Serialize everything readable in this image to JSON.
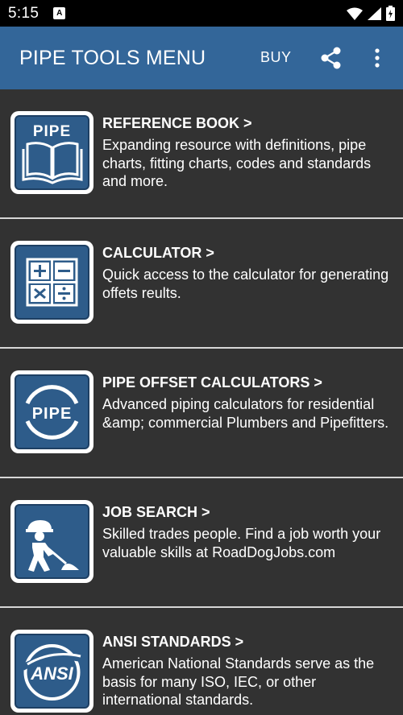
{
  "status": {
    "time": "5:15",
    "notif_icon": "A"
  },
  "appbar": {
    "title": "PIPE TOOLS MENU",
    "buy_label": "BUY",
    "color": "#336699"
  },
  "menu": [
    {
      "title": "REFERENCE BOOK  >",
      "desc": "Expanding resource with definitions, pipe charts, fitting charts, codes and standards and more.",
      "icon": "pipe-book-icon",
      "icon_text": "PIPE"
    },
    {
      "title": "CALCULATOR  >",
      "desc": "Quick access to the calculator for generating offets reults.",
      "icon": "calculator-icon"
    },
    {
      "title": "PIPE OFFSET CALCULATORS  >",
      "desc": "Advanced piping calculators for residential &amp; commercial Plumbers and Pipefitters.",
      "icon": "pipe-circle-icon",
      "icon_text": "PIPE"
    },
    {
      "title": "JOB SEARCH  >",
      "desc": "Skilled trades people. Find a job worth your valuable skills at RoadDogJobs.com",
      "icon": "worker-shovel-icon"
    },
    {
      "title": "ANSI STANDARDS  >",
      "desc": "American National Standards serve as the basis for many ISO, IEC, or other international standards.",
      "icon": "ansi-logo-icon",
      "icon_text": "ANSI"
    }
  ]
}
